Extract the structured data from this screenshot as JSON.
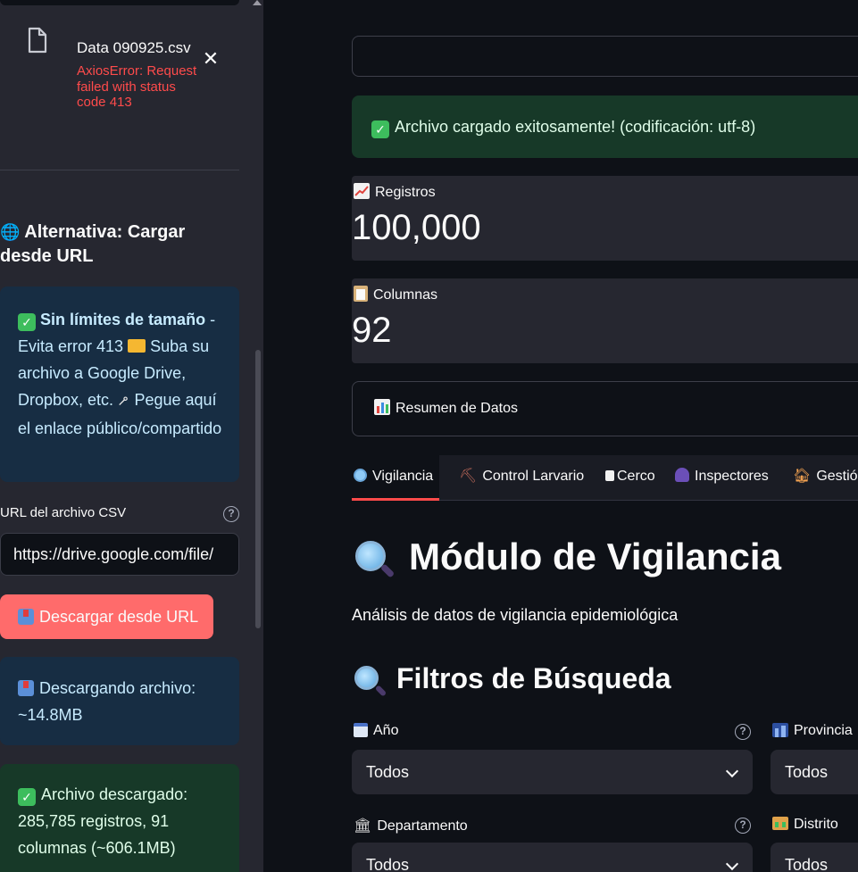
{
  "sidebar": {
    "file": {
      "name": "Data 090925.csv",
      "error": "AxiosError: Request failed with status code 413"
    },
    "alt_heading_icon": "🌐",
    "alt_heading": "Alternativa: Cargar desde URL",
    "info": {
      "bold": "Sin límites de tamaño",
      "rest_1": " - Evita error 413 ",
      "rest_2": " Suba su archivo a Google Drive, Dropbox, etc. ",
      "rest_3": " Pegue aquí el enlace público/compartido"
    },
    "url_label": "URL del archivo CSV",
    "url_value": "https://drive.google.com/file/",
    "download_button": "Descargar desde URL",
    "downloading": "Descargando archivo: ~14.8MB",
    "downloaded": "Archivo descargado: 285,785 registros, 91 columnas (~606.1MB)"
  },
  "main": {
    "alert_ok": "Archivo cargado exitosamente! (codificación: utf-8)",
    "metrics": [
      {
        "label": "Registros",
        "value": "100,000"
      },
      {
        "label": "Columnas",
        "value": "92"
      }
    ],
    "summary_expander": "Resumen de Datos",
    "tabs": [
      {
        "label": "Vigilancia",
        "active": true
      },
      {
        "label": "Control Larvario",
        "active": false
      },
      {
        "label": "Cerco",
        "active": false
      },
      {
        "label": "Inspectores",
        "active": false
      },
      {
        "label": "Gestió",
        "active": false
      }
    ],
    "title": "Módulo de Vigilancia",
    "caption": "Análisis de datos de vigilancia epidemiológica",
    "filters_heading": "Filtros de Búsqueda",
    "filters": [
      {
        "label": "Año",
        "value": "Todos"
      },
      {
        "label": "Provincia",
        "value": "Todos"
      },
      {
        "label": "Departamento",
        "value": "Todos"
      },
      {
        "label": "Distrito",
        "value": "Todos"
      }
    ]
  },
  "colors": {
    "accent": "#ff4b4b",
    "button": "#ff6b6b",
    "info_bg": "#172d43",
    "success_bg": "#173928",
    "sidebar_bg": "#262730",
    "main_bg": "#0e1117"
  }
}
